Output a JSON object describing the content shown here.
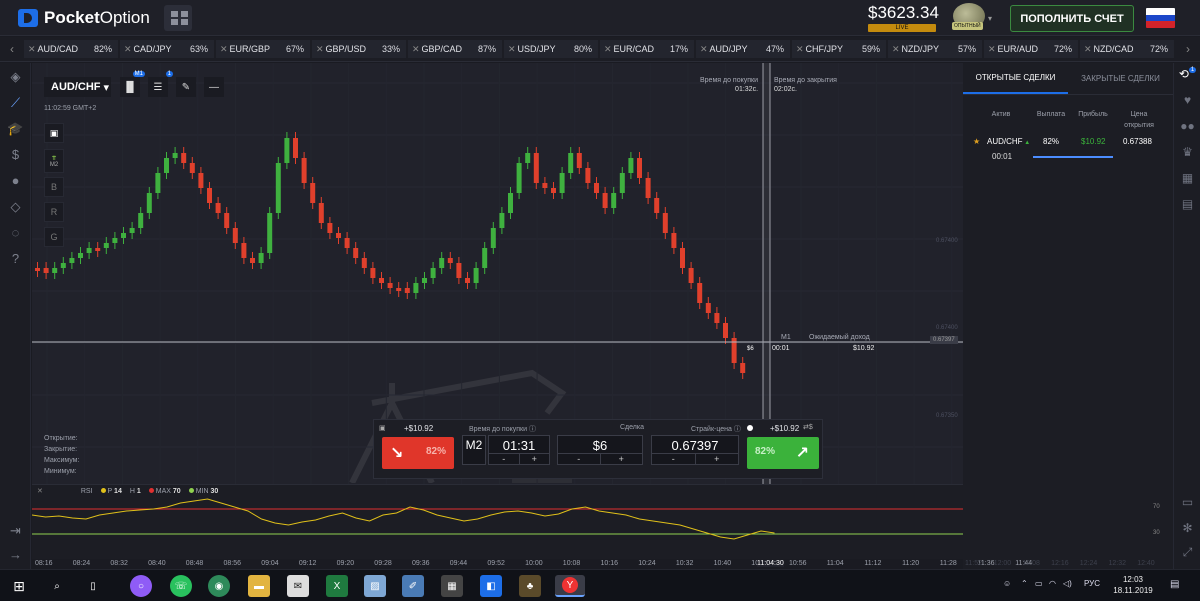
{
  "app": {
    "brand_bold": "Pocket",
    "brand_light": "Option"
  },
  "header": {
    "balance": "$3623.34",
    "balance_tag": "LIVE",
    "level_badge": "ОПЫТНЫЙ",
    "deposit_label": "ПОПОЛНИТЬ СЧЕТ"
  },
  "tickers": [
    {
      "pair": "AUD/CAD",
      "pct": "82%"
    },
    {
      "pair": "CAD/JPY",
      "pct": "63%"
    },
    {
      "pair": "EUR/GBP",
      "pct": "67%"
    },
    {
      "pair": "GBP/USD",
      "pct": "33%"
    },
    {
      "pair": "GBP/CAD",
      "pct": "87%"
    },
    {
      "pair": "USD/JPY",
      "pct": "80%"
    },
    {
      "pair": "EUR/CAD",
      "pct": "17%"
    },
    {
      "pair": "AUD/JPY",
      "pct": "47%"
    },
    {
      "pair": "CHF/JPY",
      "pct": "59%"
    },
    {
      "pair": "NZD/JPY",
      "pct": "57%"
    },
    {
      "pair": "EUR/AUD",
      "pct": "72%"
    },
    {
      "pair": "NZD/CAD",
      "pct": "72%"
    },
    {
      "pair": "GBI",
      "pct": ""
    }
  ],
  "chart": {
    "asset": "AUD/CHF",
    "clock": "11:02:59 GMT+2",
    "timeframe_badge": "M1",
    "indicator_count": "1",
    "side_timeframe": "M2",
    "side_buttons": [
      "B",
      "R",
      "G"
    ],
    "ohlc_labels": [
      "Открытие:",
      "Закрытие:",
      "Максимум:",
      "Минимум:"
    ],
    "buy_time_label": "Время до покупки",
    "buy_time_value": "01:32с.",
    "close_time_label": "Время до закрытия",
    "close_time_value": "02:02с.",
    "trade_marker": "$6",
    "trade_tf": "M1",
    "trade_timer": "00:01",
    "expected_label": "Ожидаемый доход",
    "expected_value": "$10.92",
    "price_levels": [
      "0.67400",
      "0.67400",
      "0.67397",
      "0.67350"
    ],
    "time_ticks": [
      "08:16",
      "08:24",
      "08:32",
      "08:40",
      "08:48",
      "08:56",
      "09:04",
      "09:12",
      "09:20",
      "09:28",
      "09:36",
      "09:44",
      "09:52",
      "10:00",
      "10:08",
      "10:16",
      "10:24",
      "10:32",
      "10:40",
      "10:48",
      "10:56",
      "11:04",
      "11:12",
      "11:20",
      "11:28",
      "11:36",
      "11:44"
    ],
    "time_current": "11:04:30",
    "time_ticks_faded": [
      "11:52",
      "12:00",
      "12:08",
      "12:16",
      "12:24",
      "12:32",
      "12:40",
      "12:48",
      "12:56"
    ]
  },
  "trade_panel": {
    "profit_down": "+$10.92",
    "profit_up": "+$10.92",
    "down_pct": "82%",
    "up_pct": "82%",
    "buy_time_label": "Время до покупки",
    "timeframe": "M2",
    "time_value": "01:31",
    "amount_label": "Сделка",
    "amount_value": "$6",
    "strike_label": "Страйк-цена",
    "strike_value": "0.67397",
    "minus": "-",
    "plus": "+",
    "currency_switch": "$"
  },
  "rsi": {
    "label": "RSI",
    "period_label": "P",
    "period": "14",
    "tf_label": "H",
    "tf": "1",
    "max_label": "MAX",
    "max": "70",
    "min_label": "MIN",
    "min": "30",
    "level_high": "70",
    "level_low": "30",
    "colors": {
      "line": "#e0c01a",
      "max": "#e03030",
      "min": "#8fd14f"
    }
  },
  "right_panel": {
    "tab_open": "ОТКРЫТЫЕ СДЕЛКИ",
    "tab_closed": "ЗАКРЫТЫЕ СДЕЛКИ",
    "col_asset": "Актив",
    "col_payout": "Выплата",
    "col_profit": "Прибыль",
    "col_price": "Цена открытия",
    "trade": {
      "asset": "AUD/CHF",
      "payout": "82%",
      "profit": "$10.92",
      "price": "0.67388",
      "timer": "00:01"
    },
    "nav_badge": "1"
  },
  "taskbar": {
    "lang": "РУС",
    "time": "12:03",
    "date": "18.11.2019"
  }
}
